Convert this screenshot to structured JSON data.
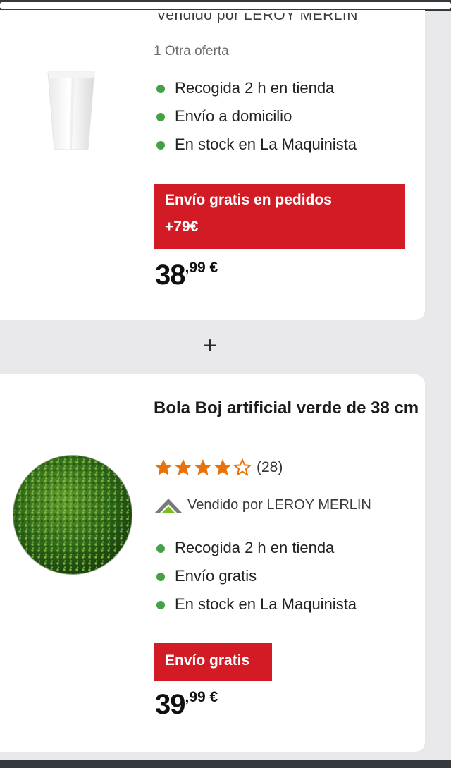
{
  "product_1": {
    "seller_label": "Vendido por LEROY MERLIN",
    "offers_label": "1 Otra oferta",
    "features": [
      "Recogida 2 h en tienda",
      "Envío a domicilio",
      "En stock en La Maquinista"
    ],
    "promo_line_1": "Envío gratis en pedidos",
    "promo_line_2": "+79€",
    "price_int": "38",
    "price_dec": ",99",
    "price_currency": " €",
    "image_icon": "white-planter-image"
  },
  "add_button": {
    "label": "+"
  },
  "product_2": {
    "title": "Bola Boj artificial verde de 38 cm",
    "rating_value": 4,
    "rating_max": 5,
    "review_count": "(28)",
    "seller_label": "Vendido por LEROY MERLIN",
    "seller_icon": "leroy-merlin-logo-icon",
    "features": [
      "Recogida 2 h en tienda",
      "Envío gratis",
      "En stock en La Maquinista"
    ],
    "promo": "Envío gratis",
    "price_int": "39",
    "price_dec": ",99",
    "price_currency": " €",
    "image_icon": "boxwood-ball-image"
  },
  "colors": {
    "promo_red": "#d21b24",
    "stock_green": "#46a046",
    "star_orange": "#e8730c",
    "brand_green": "#78be20"
  }
}
